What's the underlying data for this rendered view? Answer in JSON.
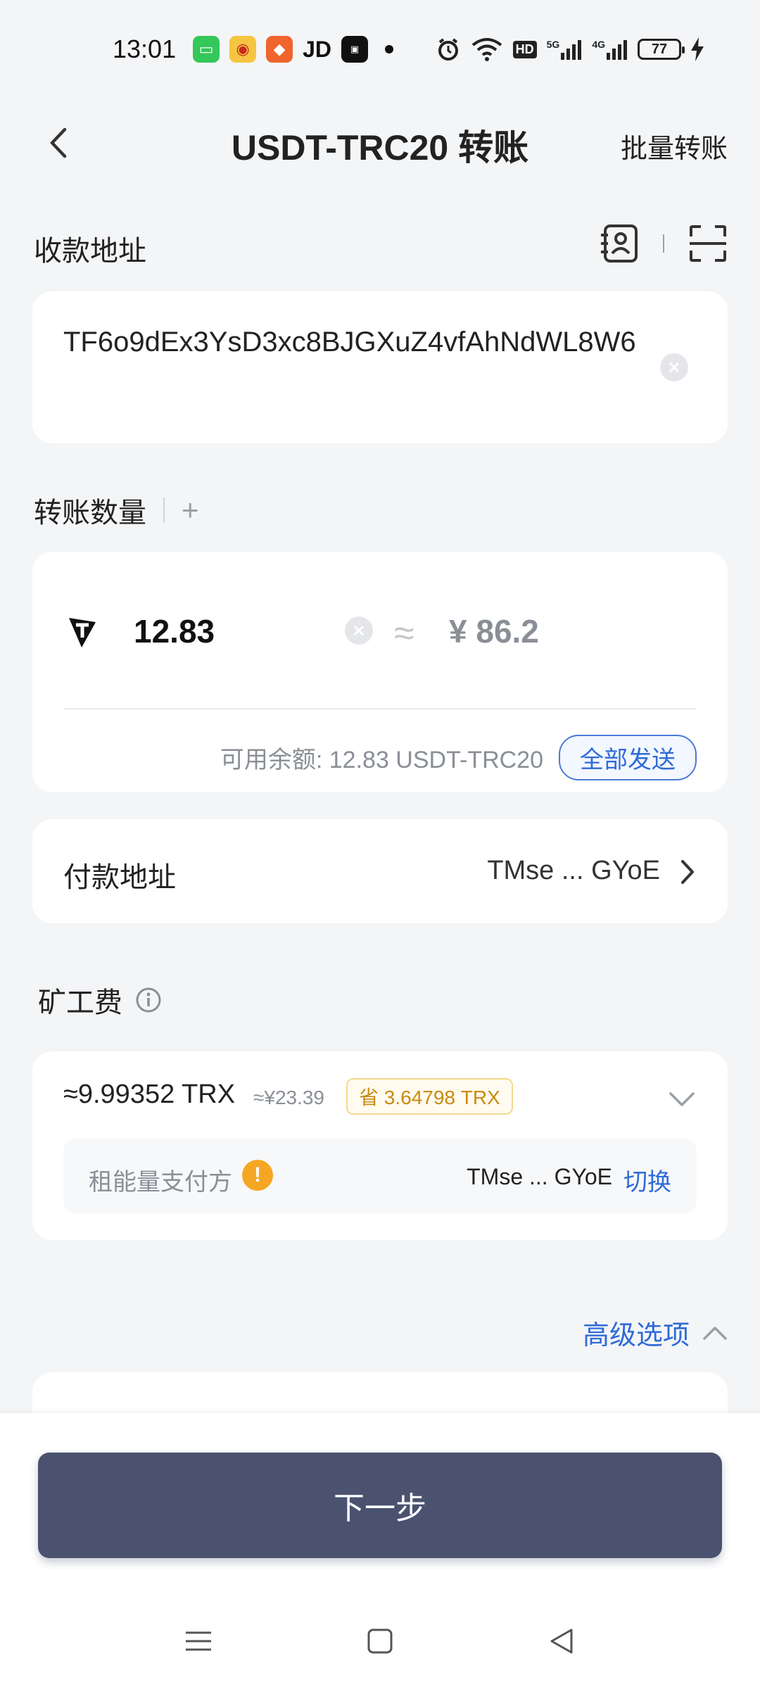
{
  "status_bar": {
    "time": "13:01",
    "notification_icons": [
      "messages-icon",
      "weibo-icon",
      "taobao-icon",
      "jd-icon",
      "app-icon",
      "dot-icon"
    ],
    "jd_label": "JD",
    "network_labels": [
      "HD",
      "5G",
      "4G"
    ],
    "battery": "77"
  },
  "header": {
    "title": "USDT-TRC20 转账",
    "batch_label": "批量转账"
  },
  "recipient": {
    "label": "收款地址",
    "address": "TF6o9dEx3YsD3xc8BJGXuZ4vfAhNdWL8W6"
  },
  "amount": {
    "label": "转账数量",
    "plus": "+",
    "value": "12.83",
    "approx": "≈",
    "fiat": "¥ 86.2",
    "balance_text": "可用余额: 12.83 USDT-TRC20",
    "send_all_label": "全部发送"
  },
  "payer": {
    "label": "付款地址",
    "address": "TMse ... GYoE"
  },
  "fee": {
    "label": "矿工费",
    "amount": "≈9.99352 TRX",
    "fiat": "≈¥23.39",
    "save_label": "省 3.64798 TRX",
    "payer_label": "租能量支付方",
    "warning_mark": "!",
    "payer_address": "TMse ... GYoE",
    "switch_label": "切换"
  },
  "advanced": {
    "label": "高级选项"
  },
  "footer": {
    "next_label": "下一步"
  },
  "colors": {
    "accent": "#2f6bd8",
    "primary_button": "#4a5270",
    "warning": "#f5a623",
    "save_badge": "#c88a10"
  }
}
